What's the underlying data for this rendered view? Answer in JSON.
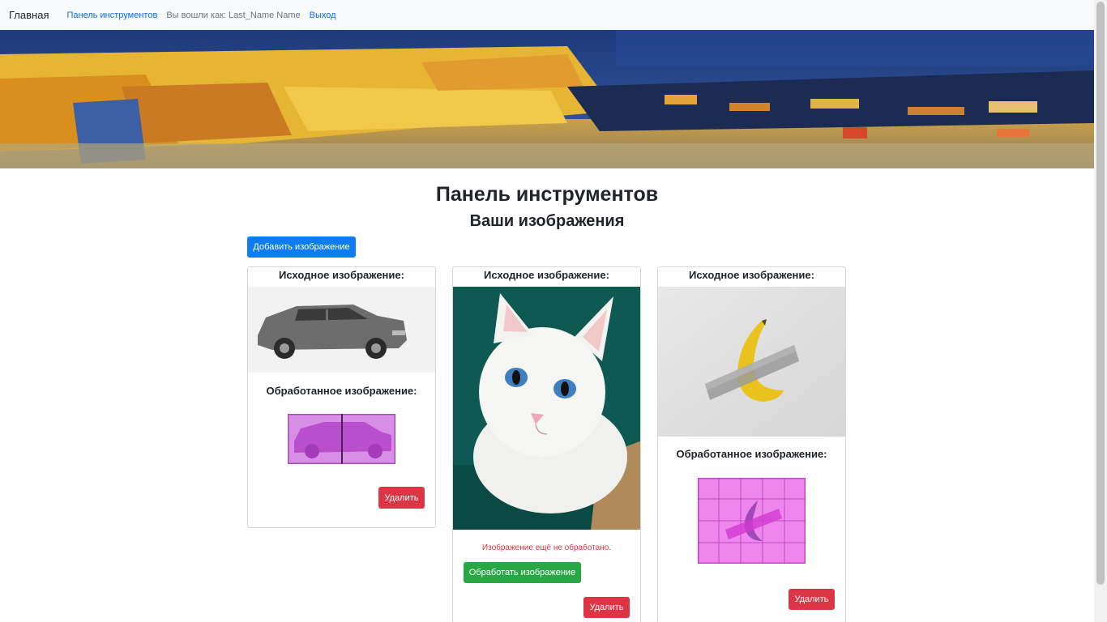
{
  "nav": {
    "brand": "Главная",
    "dashboard_link": "Панель инструментов",
    "logged_in_text": "Вы вошли как: Last_Name Name",
    "logout_link": "Выход"
  },
  "page": {
    "title": "Панель инструментов",
    "subtitle": "Ваши изображения",
    "add_button": "Добавить изображение"
  },
  "cards": [
    {
      "original_label": "Исходное изображение:",
      "processed_label": "Обработанное изображение:",
      "delete_label": "Удалить"
    },
    {
      "original_label": "Исходное изображение:",
      "status_text": "Изображение ещё не обработано.",
      "process_label": "Обработать изображение",
      "delete_label": "Удалить"
    },
    {
      "original_label": "Исходное изображение:",
      "processed_label": "Обработанное изображение:",
      "delete_label": "Удалить"
    }
  ],
  "colors": {
    "primary": "#0d7bf2",
    "success": "#28a745",
    "danger": "#dc3545",
    "link": "#0d6efd"
  },
  "icons": [
    "car-photo",
    "cat-photo",
    "banana-photo",
    "banner-painting"
  ]
}
